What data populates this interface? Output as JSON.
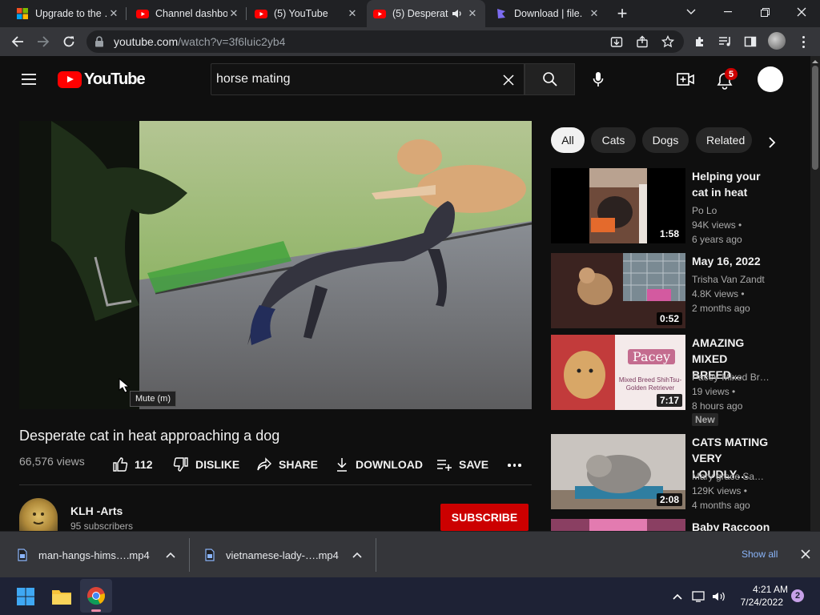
{
  "browser": {
    "tabs": [
      {
        "title": "Upgrade to the …",
        "icon": "windows-icon"
      },
      {
        "title": "Channel dashbo",
        "icon": "youtube-icon"
      },
      {
        "title": "(5) YouTube",
        "icon": "youtube-icon"
      },
      {
        "title": "(5) Desperat",
        "icon": "youtube-icon",
        "active": true
      },
      {
        "title": "Download | file.",
        "icon": "download-site-icon"
      }
    ],
    "url_host": "youtube.com",
    "url_path": "/watch?v=3f6luic2yb4"
  },
  "youtube": {
    "logo_text": "YouTube",
    "search_value": "horse mating",
    "notification_count": "5"
  },
  "video": {
    "tooltip": "Mute (m)",
    "title": "Desperate cat in heat approaching a dog",
    "views": "66,576 views",
    "likes": "112",
    "dislike_label": "DISLIKE",
    "share_label": "SHARE",
    "download_label": "DOWNLOAD",
    "save_label": "SAVE",
    "channel_name": "KLH -Arts",
    "subscribers": "95 subscribers",
    "subscribe_label": "SUBSCRIBE"
  },
  "chips": [
    "All",
    "Cats",
    "Dogs",
    "Related"
  ],
  "recommendations": [
    {
      "title": "Helping your cat in heat",
      "channel": "Po Lo",
      "views": "94K views •",
      "age": "6 years ago",
      "duration": "1:58"
    },
    {
      "title": "May 16, 2022",
      "channel": "Trisha Van Zandt",
      "views": "4.8K views •",
      "age": "2 months ago",
      "duration": "0:52"
    },
    {
      "title": "AMAZING MIXED BREED…",
      "channel": "Pacey-Mixed Bre…",
      "views": "19 views •",
      "age": "8 hours ago",
      "duration": "7:17",
      "badge": "New",
      "thumb_text_1": "Pacey",
      "thumb_text_2": "Mixed Breed ShihTsu-Golden Retriever"
    },
    {
      "title": "CATS MATING VERY LOUDLY…",
      "channel": "Mary grace Sam…",
      "views": "129K views •",
      "age": "4 months ago",
      "duration": "2:08"
    },
    {
      "title": "Baby Raccoon",
      "channel": "",
      "views": "",
      "age": "",
      "duration": ""
    }
  ],
  "downloads": {
    "items": [
      "man-hangs-hims….mp4",
      "vietnamese-lady-….mp4"
    ],
    "show_all": "Show all"
  },
  "taskbar": {
    "time": "4:21 AM",
    "date": "7/24/2022",
    "notif_count": "2"
  },
  "colors": {
    "accent_red": "#cc0000",
    "bg": "#0f0f0f",
    "chrome_dark": "#202124",
    "chrome_tab": "#35363a",
    "link_blue": "#8ab4f8"
  }
}
